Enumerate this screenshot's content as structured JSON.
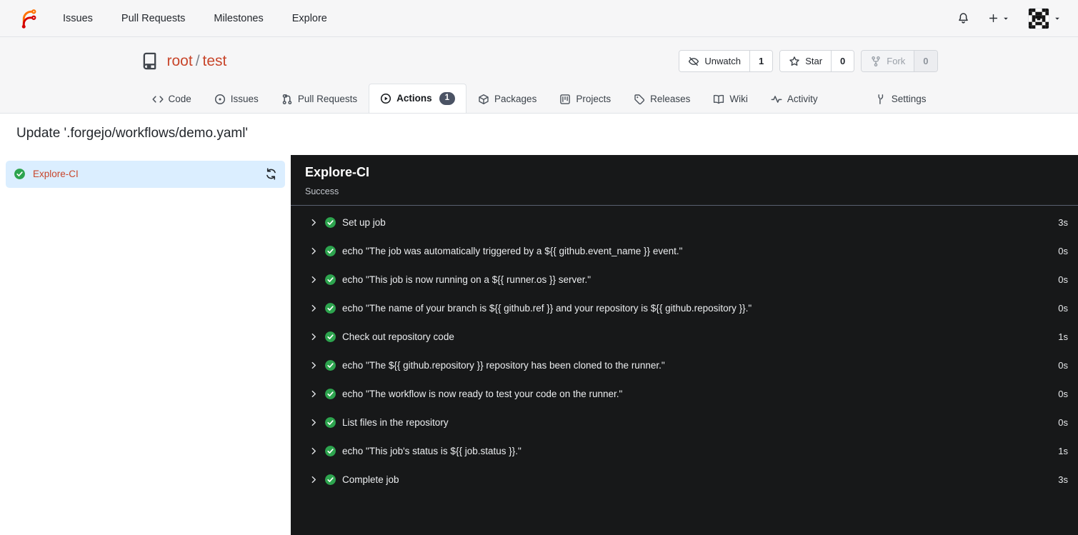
{
  "colors": {
    "accent": "#c8462b",
    "success": "#2da44e",
    "panel": "#171819",
    "selected": "#dbeeff",
    "badge": "#4b5364"
  },
  "navbar": {
    "items": [
      {
        "label": "Issues"
      },
      {
        "label": "Pull Requests"
      },
      {
        "label": "Milestones"
      },
      {
        "label": "Explore"
      }
    ],
    "right": {
      "notifications_icon": "bell",
      "create_icon": "plus",
      "user_menu_icon": "identicon"
    }
  },
  "repo": {
    "owner": "root",
    "separator": "/",
    "name": "test",
    "actions": [
      {
        "label": "Unwatch",
        "count": "1",
        "icon": "eye-off",
        "disabled": false
      },
      {
        "label": "Star",
        "count": "0",
        "icon": "star",
        "disabled": false
      },
      {
        "label": "Fork",
        "count": "0",
        "icon": "fork",
        "disabled": true
      }
    ],
    "tabs": [
      {
        "label": "Code",
        "icon": "code",
        "active": false,
        "right": false
      },
      {
        "label": "Issues",
        "icon": "issue",
        "active": false,
        "right": false
      },
      {
        "label": "Pull Requests",
        "icon": "pull-request",
        "active": false,
        "right": false
      },
      {
        "label": "Actions",
        "icon": "play-circle",
        "active": true,
        "right": false,
        "badge": "1"
      },
      {
        "label": "Packages",
        "icon": "package",
        "active": false,
        "right": false
      },
      {
        "label": "Projects",
        "icon": "project",
        "active": false,
        "right": false
      },
      {
        "label": "Releases",
        "icon": "tag",
        "active": false,
        "right": false
      },
      {
        "label": "Wiki",
        "icon": "book",
        "active": false,
        "right": false
      },
      {
        "label": "Activity",
        "icon": "pulse",
        "active": false,
        "right": false
      },
      {
        "label": "Settings",
        "icon": "tools",
        "active": false,
        "right": true
      }
    ]
  },
  "page": {
    "title": "Update '.forgejo/workflows/demo.yaml'"
  },
  "sidebar": {
    "jobs": [
      {
        "name": "Explore-CI",
        "status": "success",
        "selected": true
      }
    ]
  },
  "job_panel": {
    "title": "Explore-CI",
    "status": "Success",
    "steps": [
      {
        "name": "Set up job",
        "duration": "3s"
      },
      {
        "name": "echo \"The job was automatically triggered by a ${{ github.event_name }} event.\"",
        "duration": "0s"
      },
      {
        "name": "echo \"This job is now running on a ${{ runner.os }} server.\"",
        "duration": "0s"
      },
      {
        "name": "echo \"The name of your branch is ${{ github.ref }} and your repository is ${{ github.repository }}.\"",
        "duration": "0s"
      },
      {
        "name": "Check out repository code",
        "duration": "1s"
      },
      {
        "name": "echo \"The ${{ github.repository }} repository has been cloned to the runner.\"",
        "duration": "0s"
      },
      {
        "name": "echo \"The workflow is now ready to test your code on the runner.\"",
        "duration": "0s"
      },
      {
        "name": "List files in the repository",
        "duration": "0s"
      },
      {
        "name": "echo \"This job's status is ${{ job.status }}.\"",
        "duration": "1s"
      },
      {
        "name": "Complete job",
        "duration": "3s"
      }
    ]
  }
}
